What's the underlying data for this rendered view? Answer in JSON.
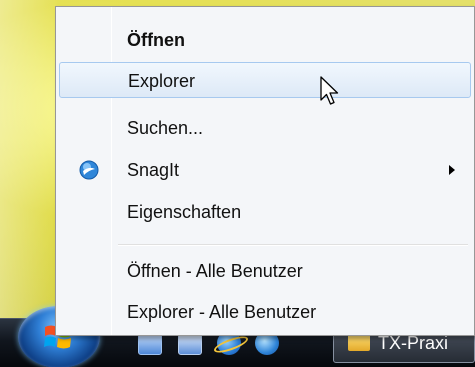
{
  "menu": {
    "items": [
      {
        "label": "Öffnen",
        "bold": true
      },
      {
        "label": "Explorer",
        "highlighted": true
      },
      {
        "label": "Suchen..."
      },
      {
        "label": "SnagIt",
        "icon": "snagit-icon",
        "submenu": true
      },
      {
        "label": "Eigenschaften"
      },
      {
        "label": "Öffnen - Alle Benutzer"
      },
      {
        "label": "Explorer - Alle Benutzer"
      }
    ]
  },
  "taskbar": {
    "task_button_label": "TX-Praxi",
    "quick_launch": [
      "show-desktop-icon",
      "switch-windows-icon",
      "internet-explorer-icon",
      "snagit-icon"
    ]
  },
  "colors": {
    "menu_background": "#f4f6f9",
    "highlight_border": "#a7c9ef",
    "desktop": "#d9d64c",
    "taskbar": "#11161e"
  }
}
